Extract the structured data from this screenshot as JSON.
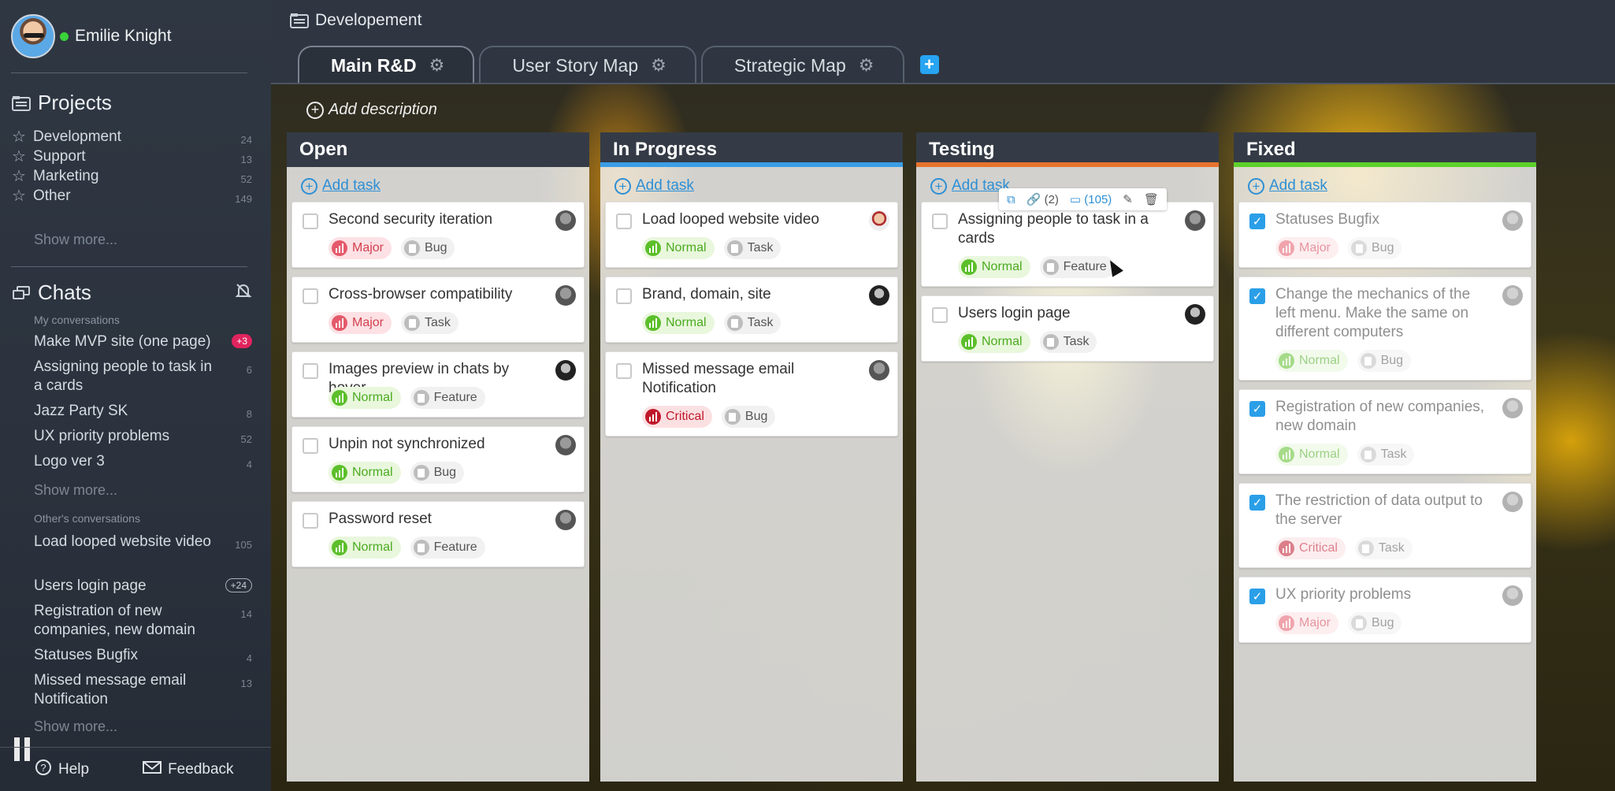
{
  "user": {
    "name": "Emilie Knight"
  },
  "projects": {
    "title": "Projects",
    "items": [
      {
        "label": "Development",
        "count": "24"
      },
      {
        "label": "Support",
        "count": "13"
      },
      {
        "label": "Marketing",
        "count": "52"
      },
      {
        "label": "Other",
        "count": "149"
      }
    ],
    "show_more": "Show more..."
  },
  "chats": {
    "title": "Chats",
    "my_heading": "My conversations",
    "my": [
      {
        "label": "Make MVP site (one page)",
        "count": "+3"
      },
      {
        "label": "Assigning people to task in a cards",
        "count": "6"
      },
      {
        "label": "Jazz Party SK",
        "count": "8"
      },
      {
        "label": "UX priority problems",
        "count": "52"
      },
      {
        "label": "Logo ver 3",
        "count": "4"
      }
    ],
    "my_show_more": "Show more...",
    "others_heading": "Other's conversations",
    "others": [
      {
        "label": "Load looped website video",
        "count": "105"
      },
      {
        "label": "Users login page",
        "count": "+24"
      },
      {
        "label": "Registration of new companies, new domain",
        "count": "14"
      },
      {
        "label": "Statuses Bugfix",
        "count": "4"
      },
      {
        "label": "Missed message email Notification",
        "count": "13"
      }
    ],
    "others_show_more": "Show more..."
  },
  "footer": {
    "help": "Help",
    "feedback": "Feedback"
  },
  "header": {
    "project": "Developement",
    "tabs": [
      "Main R&D",
      "User Story Map",
      "Strategic Map"
    ],
    "add_description": "Add description"
  },
  "add_task_label": "Add task",
  "hover_toolbar": {
    "links": "(2)",
    "comments": "(105)"
  },
  "columns": [
    {
      "title": "Open",
      "accent": "#343b46",
      "cards": [
        {
          "title": "Second security iteration",
          "priority": "Major",
          "type": "Bug",
          "done": false
        },
        {
          "title": "Cross-browser compatibility",
          "priority": "Major",
          "type": "Task",
          "done": false
        },
        {
          "title": "Images preview in chats by hover",
          "priority": "Normal",
          "type": "Feature",
          "done": false
        },
        {
          "title": "Unpin not synchronized",
          "priority": "Normal",
          "type": "Bug",
          "done": false
        },
        {
          "title": "Password reset",
          "priority": "Normal",
          "type": "Feature",
          "done": false
        }
      ]
    },
    {
      "title": "In Progress",
      "accent": "#3b9ee6",
      "cards": [
        {
          "title": "Load looped website video",
          "priority": "Normal",
          "type": "Task",
          "done": false
        },
        {
          "title": "Brand, domain, site",
          "priority": "Normal",
          "type": "Task",
          "done": false
        },
        {
          "title": "Missed message email Notification",
          "priority": "Critical",
          "type": "Bug",
          "done": false
        }
      ]
    },
    {
      "title": "Testing",
      "accent": "#e8742e",
      "cards": [
        {
          "title": "Assigning people to task in a cards",
          "priority": "Normal",
          "type": "Feature",
          "done": false
        },
        {
          "title": "Users login page",
          "priority": "Normal",
          "type": "Task",
          "done": false
        }
      ]
    },
    {
      "title": "Fixed",
      "accent": "#5cd12a",
      "cards": [
        {
          "title": "Statuses Bugfix",
          "priority": "Major",
          "type": "Bug",
          "done": true
        },
        {
          "title": "Change the mechanics of the left menu. Make the same on different computers",
          "priority": "Normal",
          "type": "Bug",
          "done": true
        },
        {
          "title": "Registration of new companies, new domain",
          "priority": "Normal",
          "type": "Task",
          "done": true
        },
        {
          "title": "The restriction of data output to the server",
          "priority": "Critical",
          "type": "Task",
          "done": true
        },
        {
          "title": "UX priority problems",
          "priority": "Major",
          "type": "Bug",
          "done": true
        }
      ]
    }
  ]
}
